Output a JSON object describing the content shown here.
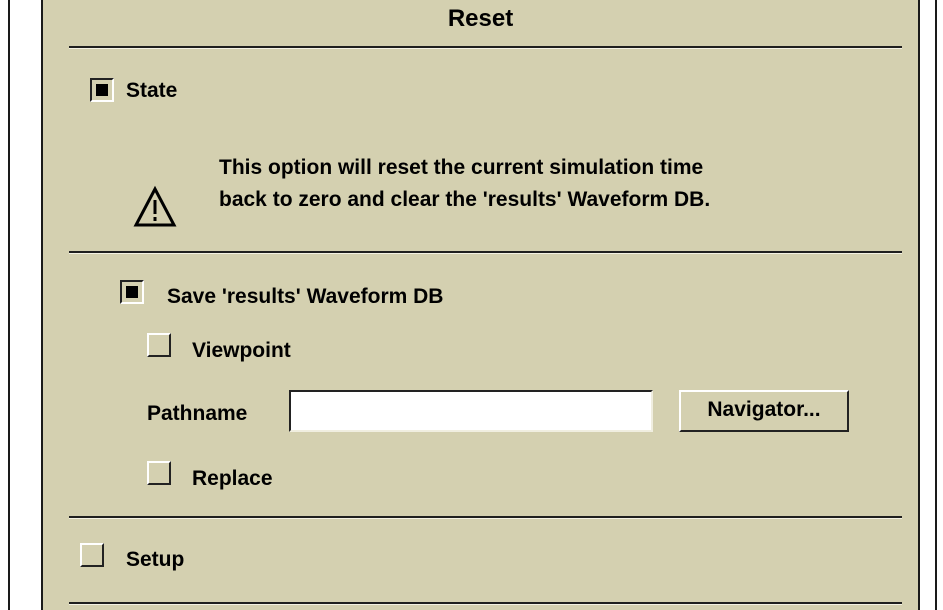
{
  "dialog": {
    "title": "Reset",
    "state": {
      "label": "State",
      "checked": true
    },
    "warning": {
      "icon": "warning-triangle-icon",
      "line1": "This option will reset the current simulation time",
      "line2": "back to zero and clear the 'results' Waveform DB."
    },
    "save_results": {
      "label": "Save 'results' Waveform DB",
      "checked": true
    },
    "viewpoint": {
      "label": "Viewpoint",
      "checked": false
    },
    "pathname": {
      "label": "Pathname",
      "value": "",
      "placeholder": ""
    },
    "navigator_button": {
      "label": "Navigator..."
    },
    "replace": {
      "label": "Replace",
      "checked": false
    },
    "setup": {
      "label": "Setup",
      "checked": false
    }
  }
}
